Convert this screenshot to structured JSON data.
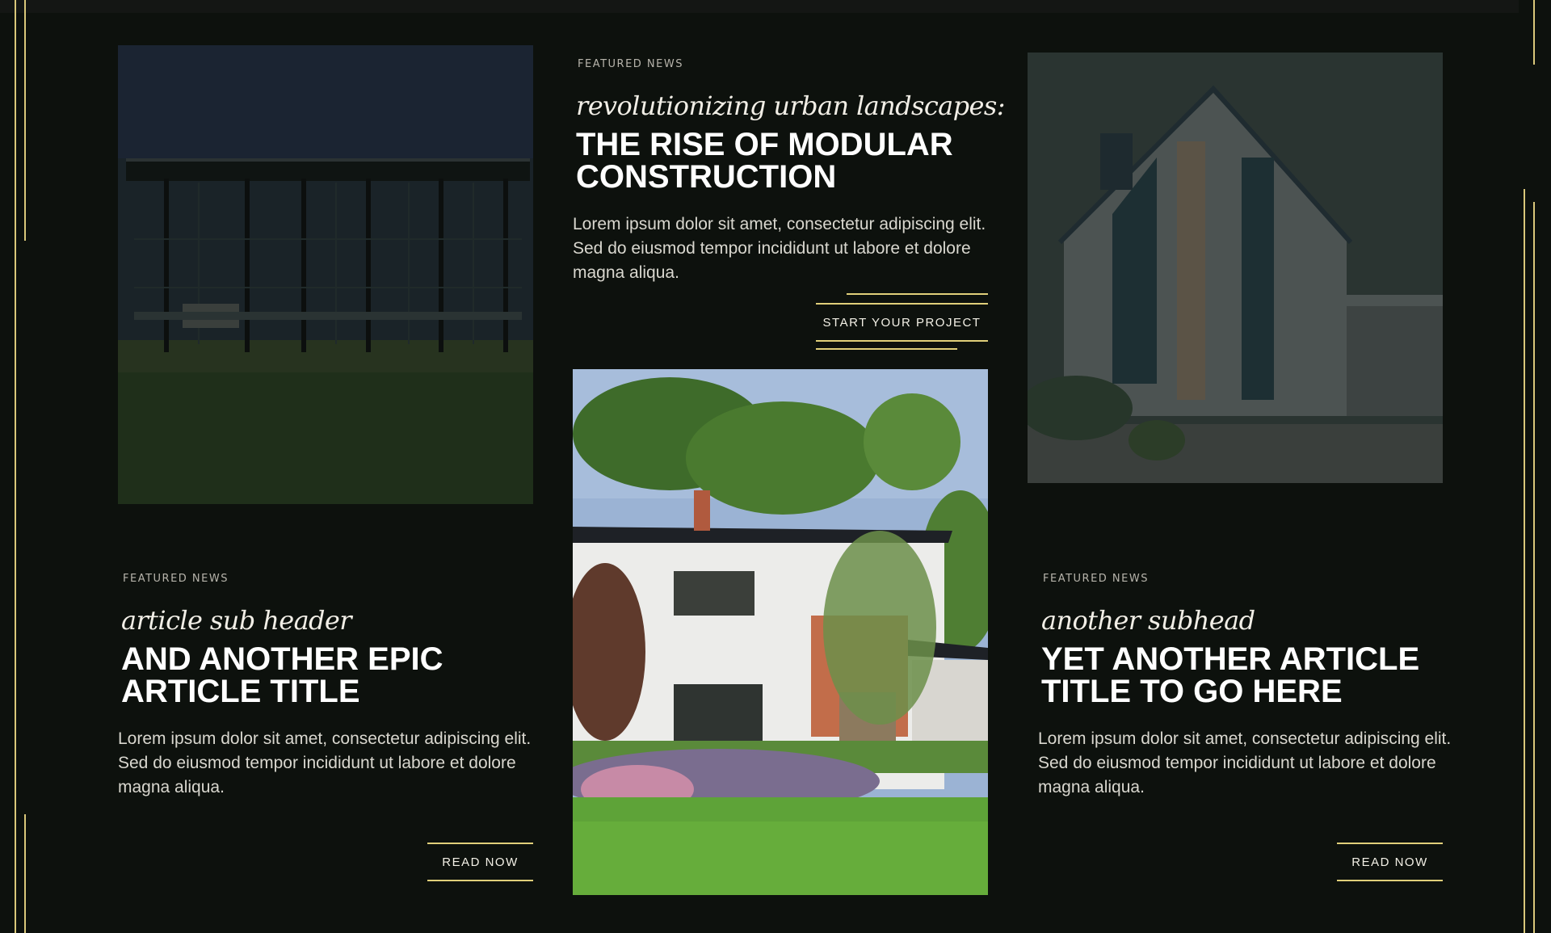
{
  "articles": {
    "featured": {
      "eyebrow": "FEATURED NEWS",
      "subhead": "revolutionizing urban landscapes:",
      "title": "THE RISE OF MODULAR CONSTRUCTION",
      "body": "Lorem ipsum dolor sit amet, consectetur adipiscing elit. Sed do eiusmod tempor incididunt ut labore et dolore magna aliqua.",
      "cta": "START YOUR PROJECT"
    },
    "left": {
      "eyebrow": "FEATURED NEWS",
      "subhead": "article sub header",
      "title": "AND ANOTHER EPIC ARTICLE TITLE",
      "body": "Lorem ipsum dolor sit amet, consectetur adipiscing elit. Sed do eiusmod tempor incididunt ut labore et dolore magna aliqua.",
      "cta": "READ NOW"
    },
    "right": {
      "eyebrow": "FEATURED NEWS",
      "subhead": "another subhead",
      "title": "YET ANOTHER ARTICLE TITLE TO GO HERE",
      "body": "Lorem ipsum dolor sit amet, consectetur adipiscing elit. Sed do eiusmod tempor incididunt ut labore et dolore magna aliqua.",
      "cta": "READ NOW"
    }
  },
  "images": {
    "left": "glass-pavilion-photo",
    "center": "white-house-garden-photo",
    "right": "modern-gable-house-photo"
  },
  "colors": {
    "background": "#0d110d",
    "accent": "#e0cf7a",
    "text": "#ffffff"
  }
}
